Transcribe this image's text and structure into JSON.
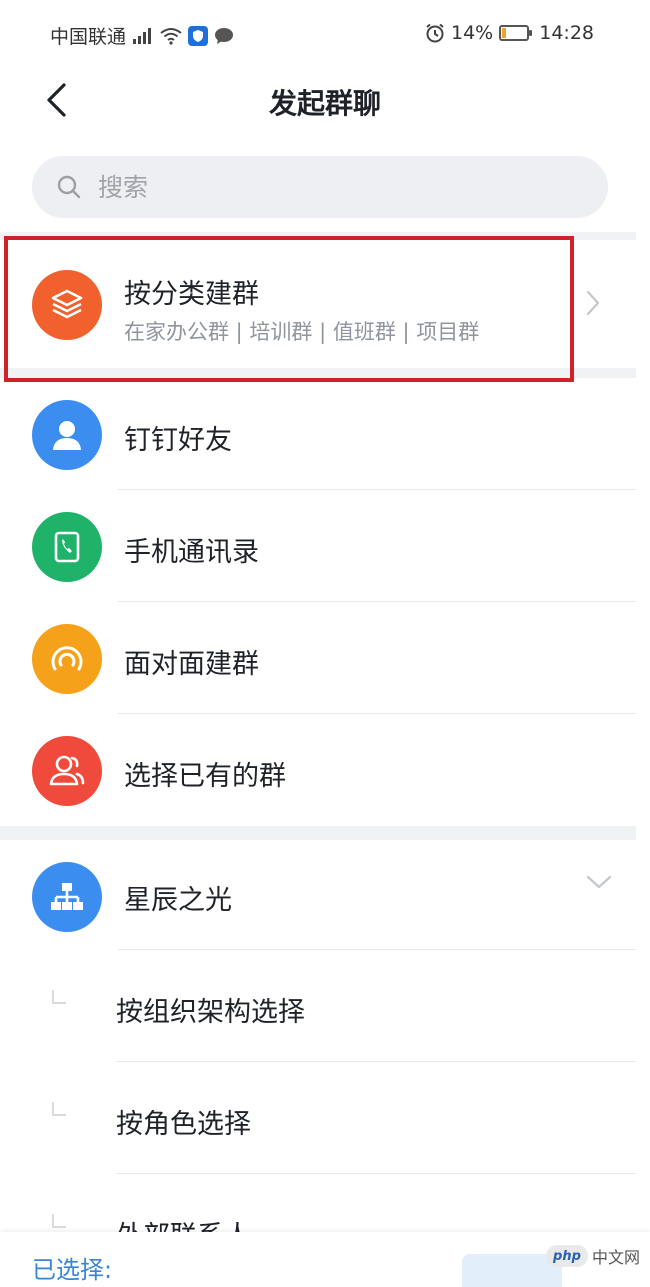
{
  "status_bar": {
    "carrier": "中国联通",
    "battery_percent": "14%",
    "battery_level": 0.14,
    "time": "14:28"
  },
  "nav": {
    "title": "发起群聊"
  },
  "search": {
    "placeholder": "搜索"
  },
  "category_group": {
    "title": "按分类建群",
    "subtitle": "在家办公群 | 培训群 | 值班群 | 项目群",
    "icon": "layers-icon",
    "color": "#f0612e"
  },
  "options": [
    {
      "label": "钉钉好友",
      "icon": "person-icon",
      "color": "#3b8ef0"
    },
    {
      "label": "手机通讯录",
      "icon": "phone-book-icon",
      "color": "#1fb36a"
    },
    {
      "label": "面对面建群",
      "icon": "signal-icon",
      "color": "#f5a11a"
    },
    {
      "label": "选择已有的群",
      "icon": "group-icon",
      "color": "#ef4a3b"
    }
  ],
  "organization": {
    "name": "星辰之光",
    "icon": "org-chart-icon",
    "color": "#3b8ef0",
    "sub_items": [
      {
        "label": "按组织架构选择"
      },
      {
        "label": "按角色选择"
      },
      {
        "label": "外部联系人"
      }
    ]
  },
  "bottom_bar": {
    "selected_label": "已选择:"
  },
  "watermark": {
    "logo_text": "php",
    "site_text": "中文网"
  },
  "colors": {
    "highlight_border": "#d0222b",
    "accent_blue": "#3a86d6"
  }
}
